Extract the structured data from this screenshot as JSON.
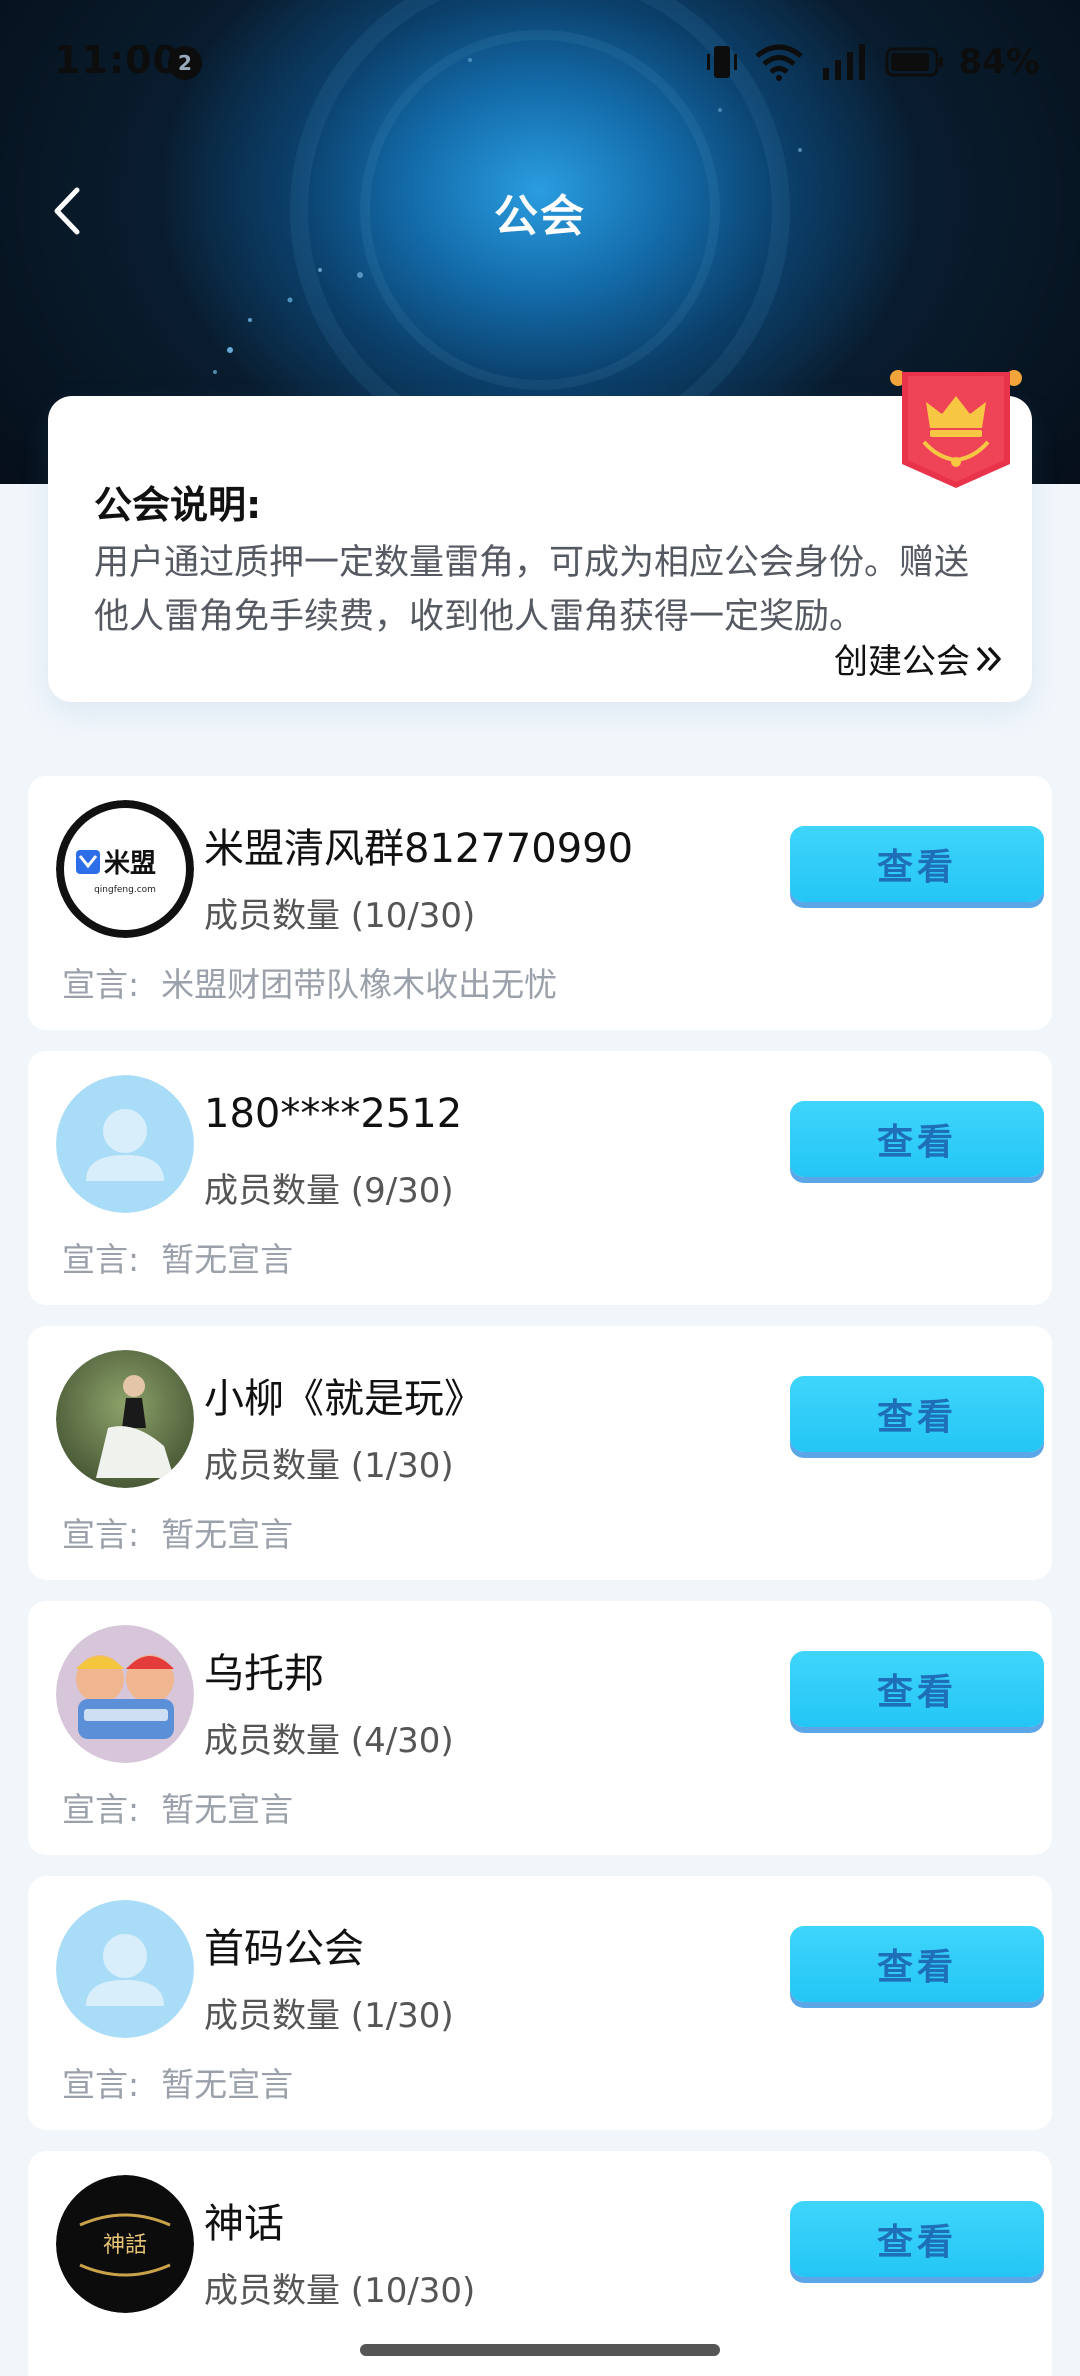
{
  "status_bar": {
    "time": "11:00",
    "notification_count": "2",
    "battery_percent": "84%",
    "icons": [
      "vibrate-icon",
      "wifi-icon",
      "signal-5g-icon",
      "battery-icon"
    ]
  },
  "header": {
    "title": "公会",
    "back_icon": "chevron-left-icon"
  },
  "info_card": {
    "title": "公会说明:",
    "description": "用户通过质押一定数量雷角，可成为相应公会身份。赠送他人雷角免手续费，收到他人雷角获得一定奖励。",
    "create_link": "创建公会",
    "create_icon": "double-chevron-right-icon",
    "badge_icon": "crown-ribbon-icon"
  },
  "guilds": [
    {
      "name": "米盟清风群812770990",
      "members": "成员数量 (10/30)",
      "motto_label": "宣言:",
      "motto": "米盟财团带队橡木收出无忧",
      "avatar": "mimeng-logo",
      "avatar_text": "米盟",
      "avatar_subtext": "qingfeng.com",
      "button": "查看"
    },
    {
      "name": "180****2512",
      "members": "成员数量 (9/30)",
      "motto_label": "宣言:",
      "motto": "暂无宣言",
      "avatar": "default-user",
      "button": "查看"
    },
    {
      "name": "小柳《就是玩》",
      "members": "成员数量 (1/30)",
      "motto_label": "宣言:",
      "motto": "暂无宣言",
      "avatar": "photo-woman-dress",
      "button": "查看"
    },
    {
      "name": "乌托邦",
      "members": "成员数量 (4/30)",
      "motto_label": "宣言:",
      "motto": "暂无宣言",
      "avatar": "cartoon-workers",
      "button": "查看"
    },
    {
      "name": "首码公会",
      "members": "成员数量 (1/30)",
      "motto_label": "宣言:",
      "motto": "暂无宣言",
      "avatar": "default-user",
      "button": "查看"
    },
    {
      "name": "神话",
      "members": "成员数量 (10/30)",
      "avatar": "shenhua-logo",
      "avatar_text": "神話",
      "button": "查看"
    }
  ],
  "colors": {
    "accent_button": "#24c6f5",
    "button_text": "#1e6fb8",
    "page_bg": "#f1f6fb",
    "ribbon": "#e8334a",
    "crown": "#f7c744"
  }
}
